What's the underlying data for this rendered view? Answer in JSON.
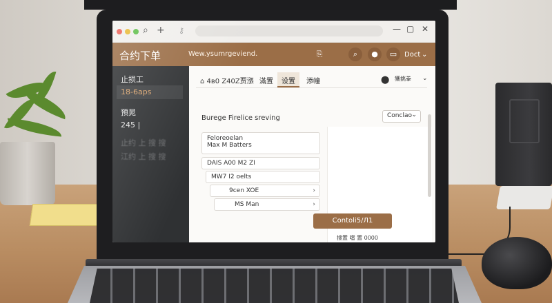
{
  "app": {
    "title": "合约下单",
    "header_subtitle": "Wew.ysumrgeviend.",
    "user_label": "Doct"
  },
  "sidebar": {
    "items": [
      {
        "label": "止损工"
      },
      {
        "label": "18-6aps"
      },
      {
        "label": "預晁"
      },
      {
        "label": "245 |"
      },
      {
        "label": "止约 上 搜 搜"
      },
      {
        "label": "江约 上 搜 搜"
      }
    ]
  },
  "tabs": [
    {
      "label": "4в0 Z40Z贾漲"
    },
    {
      "label": "滿置"
    },
    {
      "label": "设置"
    },
    {
      "label": "添幢"
    }
  ],
  "toolbar": {
    "right_label": "獲挑拳"
  },
  "content": {
    "section_title": "Burege Firelice sreving",
    "select_value": "Conclao"
  },
  "form": {
    "card1_line1": "Feloreoelan",
    "card1_line2": "Max M Batters",
    "card2": "DAIS A00 M2 ZI",
    "card3": "MW7 I2 oelts",
    "card4": "9cen XOE",
    "card5": "MS Man",
    "primary_button": "Contoli5/Л1",
    "footnote": "搜置 噹 置 0000"
  },
  "icons": {
    "search": "search-icon",
    "add": "plus-icon",
    "user": "user-icon",
    "chat": "chat-icon",
    "bell": "bell-icon"
  },
  "colors": {
    "accent": "#9b6e47",
    "sidebar": "#2f3133"
  }
}
